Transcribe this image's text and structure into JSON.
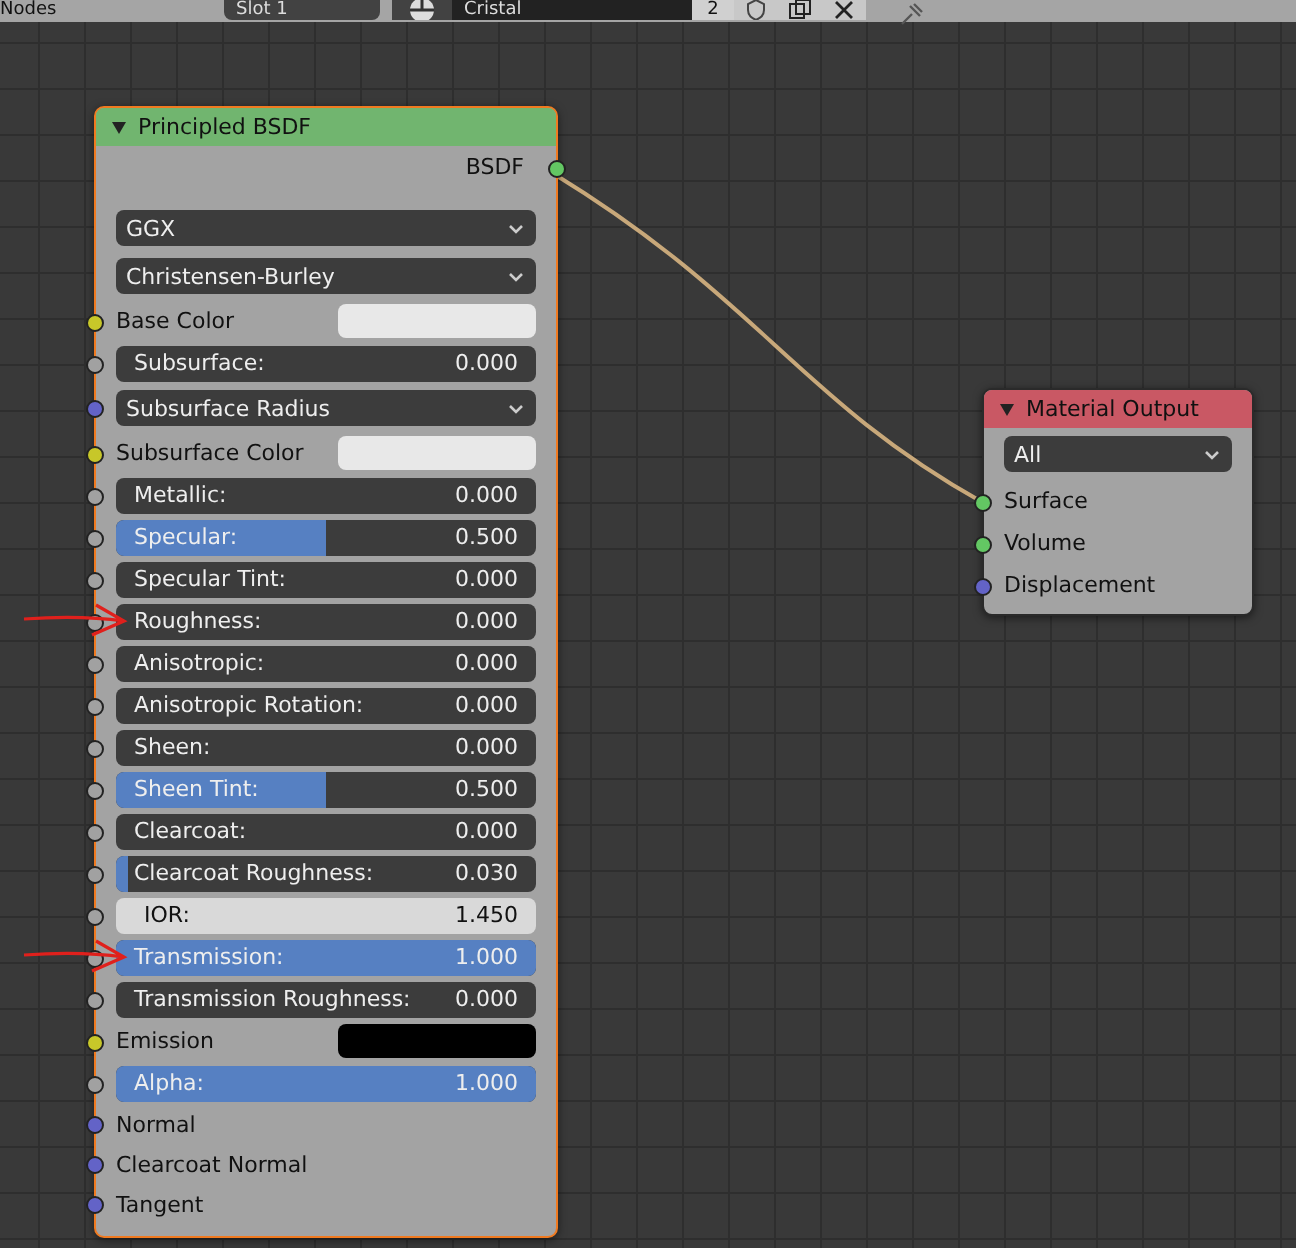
{
  "header": {
    "editor_label": "Nodes",
    "slot": "Slot 1",
    "material_name": "Cristal",
    "users": "2"
  },
  "principled_node": {
    "title": "Principled BSDF",
    "output": "BSDF",
    "rows": [
      {
        "kind": "dropdown",
        "label": "GGX"
      },
      {
        "kind": "dropdown",
        "label": "Christensen-Burley"
      },
      {
        "kind": "color",
        "label": "Base Color",
        "socket": {
          "color": "#c7c729"
        },
        "color": "#e8e8e8"
      },
      {
        "kind": "slider",
        "label": "Subsurface:",
        "value": "0.000",
        "level": 0,
        "socket": {
          "color": "#a1a1a1"
        }
      },
      {
        "kind": "dropdown",
        "label": "Subsurface Radius",
        "socket": {
          "color": "#6363c7"
        }
      },
      {
        "kind": "color",
        "label": "Subsurface Color",
        "socket": {
          "color": "#c7c729"
        },
        "color": "#e8e8e8"
      },
      {
        "kind": "slider",
        "label": "Metallic:",
        "value": "0.000",
        "level": 0,
        "socket": {
          "color": "#a1a1a1"
        }
      },
      {
        "kind": "slider",
        "label": "Specular:",
        "value": "0.500",
        "level": 0.5,
        "socket": {
          "color": "#a1a1a1"
        }
      },
      {
        "kind": "slider",
        "label": "Specular Tint:",
        "value": "0.000",
        "level": 0,
        "socket": {
          "color": "#a1a1a1"
        }
      },
      {
        "kind": "slider",
        "label": "Roughness:",
        "value": "0.000",
        "level": 0,
        "socket": {
          "color": "#a1a1a1"
        },
        "annotated": true
      },
      {
        "kind": "slider",
        "label": "Anisotropic:",
        "value": "0.000",
        "level": 0,
        "socket": {
          "color": "#a1a1a1"
        }
      },
      {
        "kind": "slider",
        "label": "Anisotropic Rotation:",
        "value": "0.000",
        "level": 0,
        "socket": {
          "color": "#a1a1a1"
        }
      },
      {
        "kind": "slider",
        "label": "Sheen:",
        "value": "0.000",
        "level": 0,
        "socket": {
          "color": "#a1a1a1"
        }
      },
      {
        "kind": "slider",
        "label": "Sheen Tint:",
        "value": "0.500",
        "level": 0.5,
        "socket": {
          "color": "#a1a1a1"
        }
      },
      {
        "kind": "slider",
        "label": "Clearcoat:",
        "value": "0.000",
        "level": 0,
        "socket": {
          "color": "#a1a1a1"
        }
      },
      {
        "kind": "slider",
        "label": "Clearcoat Roughness:",
        "value": "0.030",
        "level": 0.03,
        "socket": {
          "color": "#a1a1a1"
        }
      },
      {
        "kind": "number",
        "label": "IOR:",
        "value": "1.450",
        "socket": {
          "color": "#a1a1a1"
        }
      },
      {
        "kind": "slider",
        "label": "Transmission:",
        "value": "1.000",
        "level": 1,
        "socket": {
          "color": "#a1a1a1"
        },
        "annotated": true
      },
      {
        "kind": "slider",
        "label": "Transmission Roughness:",
        "value": "0.000",
        "level": 0,
        "socket": {
          "color": "#a1a1a1"
        }
      },
      {
        "kind": "color",
        "label": "Emission",
        "socket": {
          "color": "#c7c729"
        },
        "color": "#000000"
      },
      {
        "kind": "slider",
        "label": "Alpha:",
        "value": "1.000",
        "level": 1,
        "socket": {
          "color": "#a1a1a1"
        }
      },
      {
        "kind": "input",
        "label": "Normal",
        "socket": {
          "color": "#6363c7"
        }
      },
      {
        "kind": "input",
        "label": "Clearcoat Normal",
        "socket": {
          "color": "#6363c7"
        }
      },
      {
        "kind": "input",
        "label": "Tangent",
        "socket": {
          "color": "#6363c7"
        }
      }
    ]
  },
  "output_node": {
    "title": "Material Output",
    "target": "All",
    "inputs": [
      {
        "label": "Surface",
        "socket": {
          "color": "#63c763"
        }
      },
      {
        "label": "Volume",
        "socket": {
          "color": "#63c763"
        }
      },
      {
        "label": "Displacement",
        "socket": {
          "color": "#6363c7"
        }
      }
    ]
  }
}
